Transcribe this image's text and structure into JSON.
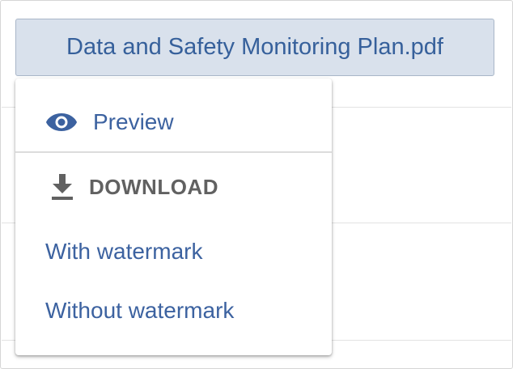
{
  "file": {
    "name": "Data and Safety Monitoring Plan.pdf"
  },
  "menu": {
    "preview_label": "Preview",
    "preview_icon": "eye-icon",
    "download_header": "DOWNLOAD",
    "download_icon": "download-icon",
    "with_watermark_label": "With watermark",
    "without_watermark_label": "Without watermark"
  },
  "colors": {
    "accent": "#3c62a0",
    "button_bg": "#d9e1ec",
    "header_text": "#616161"
  }
}
